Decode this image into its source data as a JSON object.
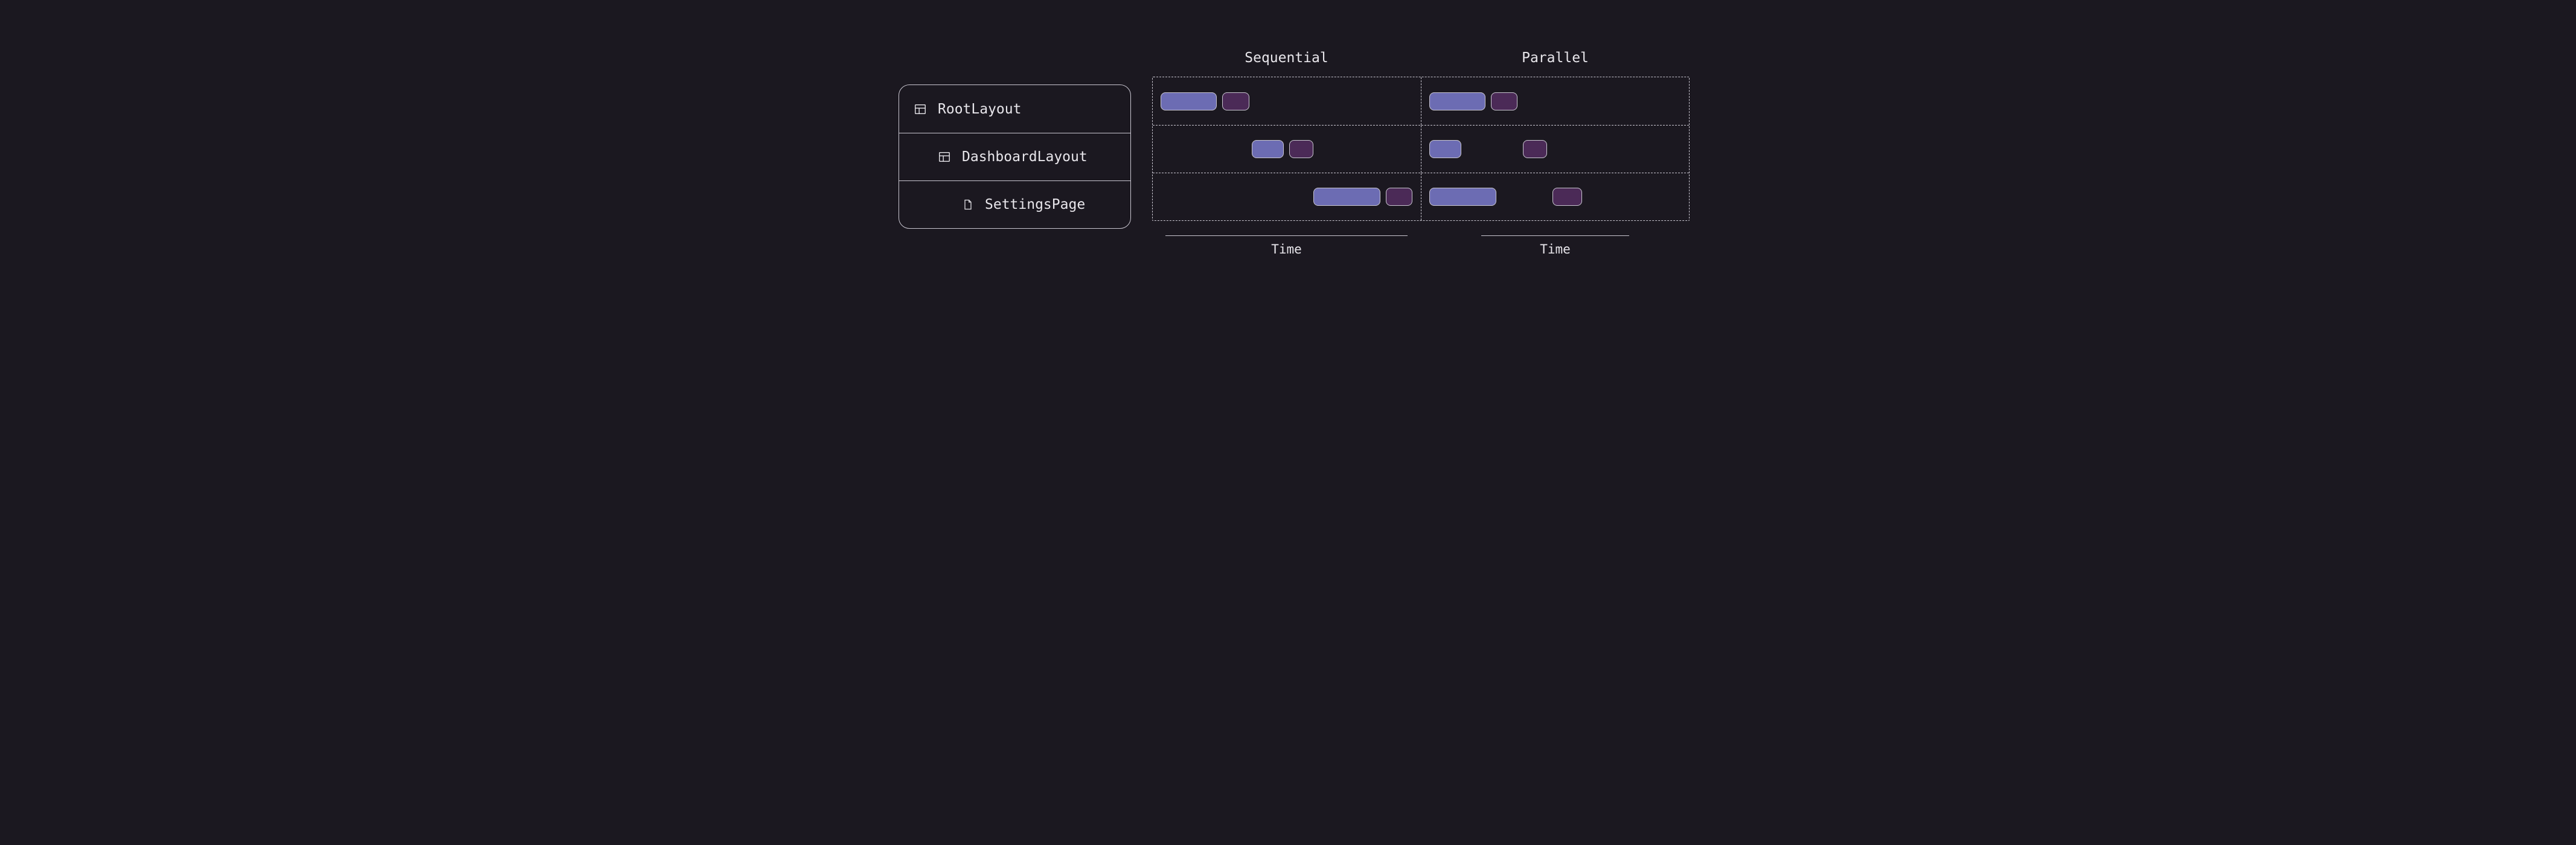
{
  "tree": {
    "items": [
      {
        "label": "RootLayout",
        "icon": "layout-icon",
        "indent": 0
      },
      {
        "label": "DashboardLayout",
        "icon": "layout-icon",
        "indent": 1
      },
      {
        "label": "SettingsPage",
        "icon": "page-icon",
        "indent": 2
      }
    ]
  },
  "colors": {
    "fetch": "#6c6cb3",
    "render": "#4b2a57",
    "stroke": "#c9c6d0",
    "bg": "#1b1820"
  },
  "timelines": {
    "columns": [
      {
        "title": "Sequential",
        "axis_label": "Time"
      },
      {
        "title": "Parallel",
        "axis_label": "Time"
      }
    ],
    "rows": [
      {
        "sequential": {
          "fetch": {
            "start": 3,
            "width": 21
          },
          "render": {
            "start": 26,
            "width": 10
          }
        },
        "parallel": {
          "fetch": {
            "start": 3,
            "width": 21
          },
          "render": {
            "start": 26,
            "width": 10
          }
        }
      },
      {
        "sequential": {
          "fetch": {
            "start": 37,
            "width": 12
          },
          "render": {
            "start": 51,
            "width": 9
          }
        },
        "parallel": {
          "fetch": {
            "start": 3,
            "width": 12
          },
          "render": {
            "start": 38,
            "width": 9
          }
        }
      },
      {
        "sequential": {
          "fetch": {
            "start": 60,
            "width": 25
          },
          "render": {
            "start": 87,
            "width": 10
          }
        },
        "parallel": {
          "fetch": {
            "start": 3,
            "width": 25
          },
          "render": {
            "start": 49,
            "width": 11
          }
        }
      }
    ]
  }
}
